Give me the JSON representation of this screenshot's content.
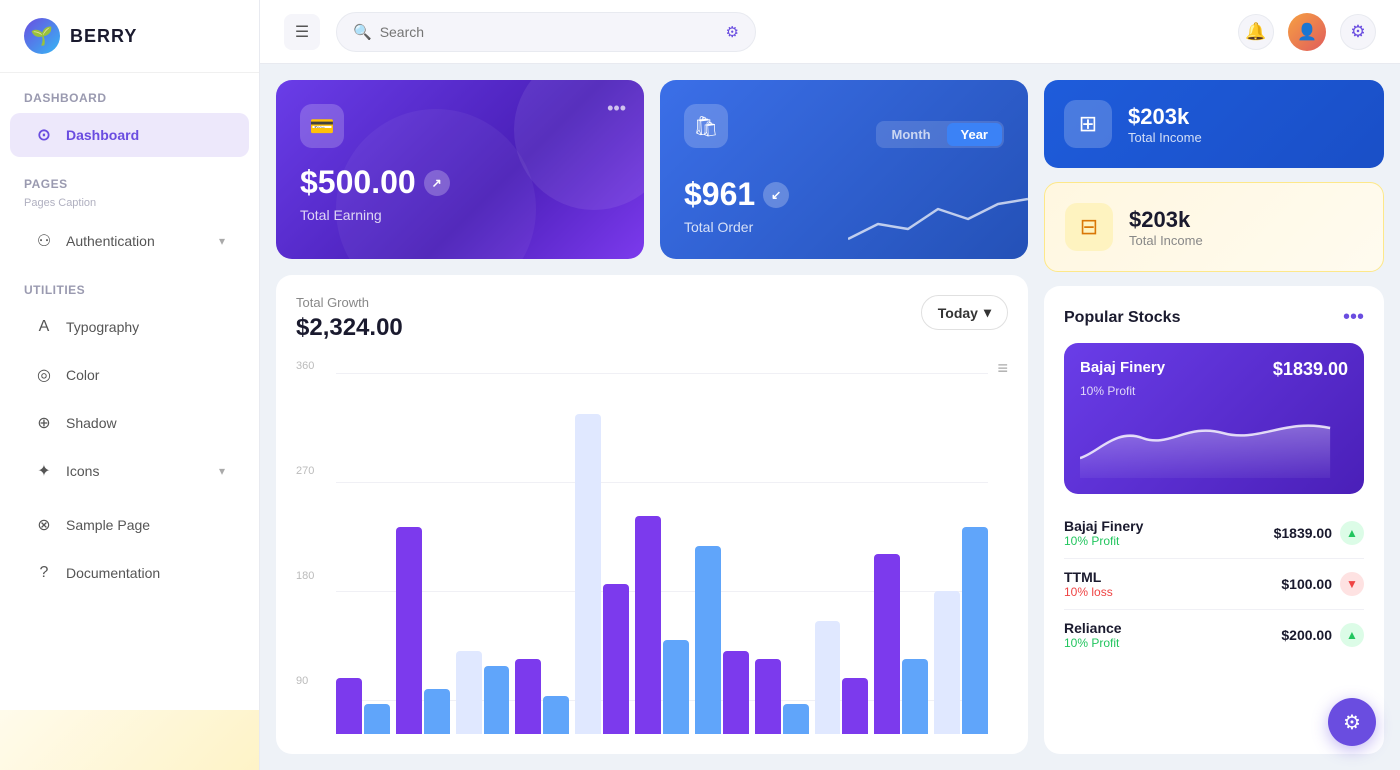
{
  "logo": {
    "icon": "🌱",
    "text": "BERRY"
  },
  "header": {
    "menu_label": "☰",
    "search_placeholder": "Search",
    "bell_icon": "🔔",
    "settings_icon": "⚙",
    "avatar_text": "U"
  },
  "sidebar": {
    "dashboard_section": "Dashboard",
    "dashboard_item": "Dashboard",
    "pages_section": "Pages",
    "pages_caption": "Pages Caption",
    "authentication_item": "Authentication",
    "utilities_section": "Utilities",
    "typography_item": "Typography",
    "color_item": "Color",
    "shadow_item": "Shadow",
    "icons_item": "Icons",
    "other_section": "",
    "sample_page_item": "Sample Page",
    "documentation_item": "Documentation"
  },
  "card_earning": {
    "amount": "$500.00",
    "label": "Total Earning",
    "three_dots": "•••"
  },
  "card_order": {
    "amount": "$961",
    "label": "Total Order",
    "tab_month": "Month",
    "tab_year": "Year"
  },
  "card_income_blue": {
    "amount": "$203k",
    "label": "Total Income"
  },
  "card_income_yellow": {
    "amount": "$203k",
    "label": "Total Income"
  },
  "chart": {
    "title": "Total Growth",
    "amount": "$2,324.00",
    "period_btn": "Today",
    "y_labels": [
      "360",
      "270",
      "180",
      "90"
    ],
    "menu_icon": "≡"
  },
  "stocks": {
    "title": "Popular Stocks",
    "more_icon": "•••",
    "featured": {
      "name": "Bajaj Finery",
      "price": "$1839.00",
      "profit": "10% Profit"
    },
    "rows": [
      {
        "name": "Bajaj Finery",
        "price": "$1839.00",
        "profit": "10% Profit",
        "trend": "up"
      },
      {
        "name": "TTML",
        "price": "$100.00",
        "profit": "10% loss",
        "trend": "down"
      },
      {
        "name": "Reliance",
        "price": "$200.00",
        "profit": "10% Profit",
        "trend": "up"
      }
    ]
  },
  "fab": {
    "icon": "⚙"
  }
}
